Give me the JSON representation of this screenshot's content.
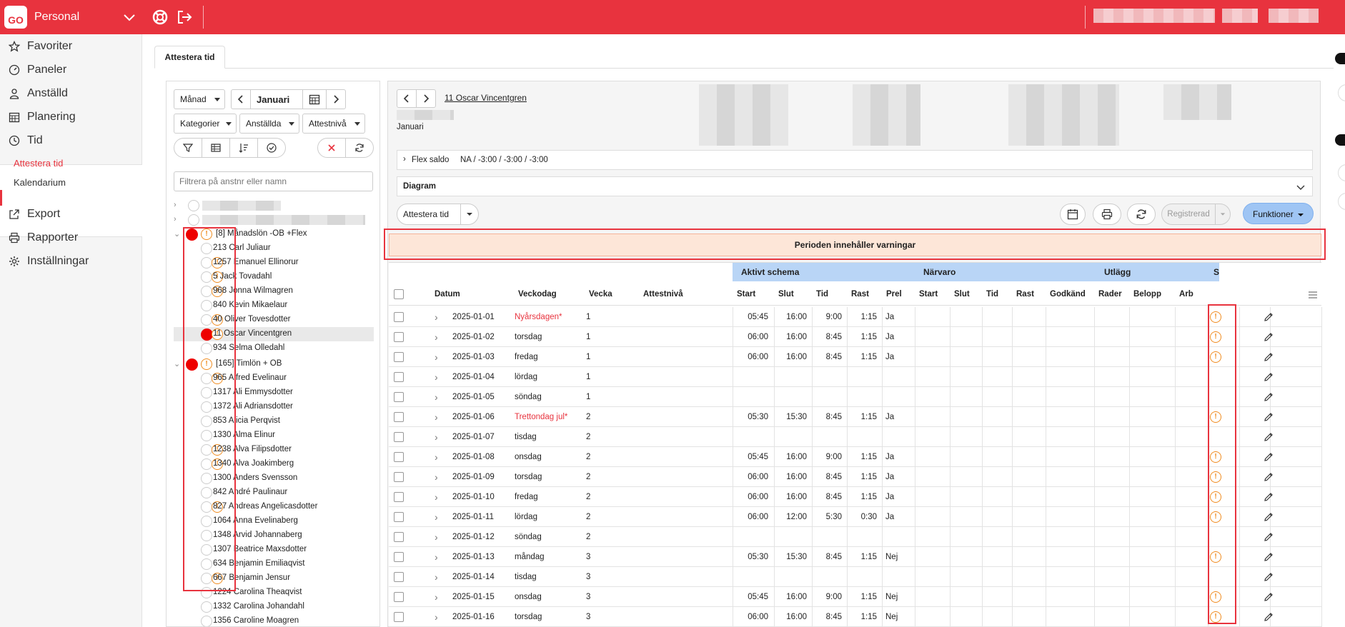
{
  "app": {
    "logo": "GO",
    "title": "Personal"
  },
  "nav": {
    "items": [
      {
        "label": "Favoriter",
        "icon": "star-icon"
      },
      {
        "label": "Paneler",
        "icon": "dashboard-icon"
      },
      {
        "label": "Anställd",
        "icon": "person-icon"
      },
      {
        "label": "Planering",
        "icon": "calendar-icon"
      },
      {
        "label": "Tid",
        "icon": "clock-icon"
      },
      {
        "label": "Export",
        "icon": "export-icon"
      },
      {
        "label": "Rapporter",
        "icon": "print-icon"
      },
      {
        "label": "Inställningar",
        "icon": "gear-icon"
      }
    ],
    "sub": [
      {
        "label": "Attestera tid",
        "active": true
      },
      {
        "label": "Kalendarium",
        "active": false
      }
    ]
  },
  "tab": {
    "label": "Attestera tid"
  },
  "filters": {
    "period": "Månad",
    "month": "Januari",
    "kategorier": "Kategorier",
    "anstallda": "Anställda",
    "attestniva": "Attestnivå",
    "search_placeholder": "Filtrera på anstnr eller namn"
  },
  "tree": {
    "groups": [
      {
        "label": "[8]  Månadslön -OB +Flex",
        "employees": [
          {
            "label": "213 Carl Juliaur",
            "warn": false
          },
          {
            "label": "1257 Emanuel Ellinorur",
            "warn": true
          },
          {
            "label": "5 Jack Tovadahl",
            "warn": true
          },
          {
            "label": "968 Jonna Wilmagren",
            "warn": true
          },
          {
            "label": "840 Kevin Mikaelaur",
            "warn": false
          },
          {
            "label": "40 Oliver Tovesdotter",
            "warn": true
          },
          {
            "label": "11 Oscar Vincentgren",
            "warn": true
          },
          {
            "label": "934 Selma Olledahl",
            "warn": false
          }
        ]
      },
      {
        "label": "[165]  Timlön + OB",
        "employees": [
          {
            "label": "965 Alfred Evelinaur",
            "warn": true
          },
          {
            "label": "1317 Ali Emmysdotter",
            "warn": false
          },
          {
            "label": "1372 Ali Adriansdotter",
            "warn": false
          },
          {
            "label": "853 Alicia Perqvist",
            "warn": false
          },
          {
            "label": "1330 Alma Elinur",
            "warn": false
          },
          {
            "label": "1238 Alva Filipsdotter",
            "warn": true
          },
          {
            "label": "1340 Alva Joakimberg",
            "warn": true
          },
          {
            "label": "1300 Anders Svensson",
            "warn": false
          },
          {
            "label": "842 André Paulinaur",
            "warn": false
          },
          {
            "label": "827 Andreas Angelicasdotter",
            "warn": true
          },
          {
            "label": "1064 Anna Evelinaberg",
            "warn": false
          },
          {
            "label": "1348 Arvid Johannaberg",
            "warn": false
          },
          {
            "label": "1307 Beatrice Maxsdotter",
            "warn": false
          },
          {
            "label": "634 Benjamin Emiliaqvist",
            "warn": false
          },
          {
            "label": "667 Benjamin Jensur",
            "warn": true
          },
          {
            "label": "1224 Carolina Theaqvist",
            "warn": false
          },
          {
            "label": "1332 Carolina Johandahl",
            "warn": false
          },
          {
            "label": "1356 Caroline Moagren",
            "warn": false
          }
        ]
      }
    ]
  },
  "employee": {
    "name": "11 Oscar Vincentgren",
    "period": "Januari",
    "flex_label": "Flex saldo",
    "flex_value": "NA / -3:00 / -3:00 / -3:00",
    "diagram": "Diagram"
  },
  "toolbar": {
    "attest_button": "Attestera tid",
    "registrerad": "Registrerad",
    "funktioner": "Funktioner"
  },
  "warning_banner": "Perioden innehåller varningar",
  "grid": {
    "groups": [
      "Aktivt schema",
      "Närvaro",
      "Utlägg",
      "St"
    ],
    "columns": [
      "Datum",
      "Veckodag",
      "Vecka",
      "Attestnivå",
      "Start",
      "Slut",
      "Tid",
      "Rast",
      "Prel",
      "Start",
      "Slut",
      "Tid",
      "Rast",
      "Godkänd",
      "Rader",
      "Belopp",
      "Arb"
    ],
    "rows": [
      {
        "date": "2025-01-01",
        "day": "Nyårsdagen*",
        "holiday": true,
        "week": "1",
        "start": "05:45",
        "end": "16:00",
        "time": "9:00",
        "rast": "1:15",
        "prel": "Ja",
        "warn": true
      },
      {
        "date": "2025-01-02",
        "day": "torsdag",
        "holiday": false,
        "week": "1",
        "start": "06:00",
        "end": "16:00",
        "time": "8:45",
        "rast": "1:15",
        "prel": "Ja",
        "warn": true
      },
      {
        "date": "2025-01-03",
        "day": "fredag",
        "holiday": false,
        "week": "1",
        "start": "06:00",
        "end": "16:00",
        "time": "8:45",
        "rast": "1:15",
        "prel": "Ja",
        "warn": true
      },
      {
        "date": "2025-01-04",
        "day": "lördag",
        "holiday": false,
        "week": "1",
        "start": "",
        "end": "",
        "time": "",
        "rast": "",
        "prel": "",
        "warn": false
      },
      {
        "date": "2025-01-05",
        "day": "söndag",
        "holiday": false,
        "week": "1",
        "start": "",
        "end": "",
        "time": "",
        "rast": "",
        "prel": "",
        "warn": false
      },
      {
        "date": "2025-01-06",
        "day": "Trettondag jul*",
        "holiday": true,
        "week": "2",
        "start": "05:30",
        "end": "15:30",
        "time": "8:45",
        "rast": "1:15",
        "prel": "Ja",
        "warn": true
      },
      {
        "date": "2025-01-07",
        "day": "tisdag",
        "holiday": false,
        "week": "2",
        "start": "",
        "end": "",
        "time": "",
        "rast": "",
        "prel": "",
        "warn": false
      },
      {
        "date": "2025-01-08",
        "day": "onsdag",
        "holiday": false,
        "week": "2",
        "start": "05:45",
        "end": "16:00",
        "time": "9:00",
        "rast": "1:15",
        "prel": "Ja",
        "warn": true
      },
      {
        "date": "2025-01-09",
        "day": "torsdag",
        "holiday": false,
        "week": "2",
        "start": "06:00",
        "end": "16:00",
        "time": "8:45",
        "rast": "1:15",
        "prel": "Ja",
        "warn": true
      },
      {
        "date": "2025-01-10",
        "day": "fredag",
        "holiday": false,
        "week": "2",
        "start": "06:00",
        "end": "16:00",
        "time": "8:45",
        "rast": "1:15",
        "prel": "Ja",
        "warn": true
      },
      {
        "date": "2025-01-11",
        "day": "lördag",
        "holiday": false,
        "week": "2",
        "start": "06:00",
        "end": "12:00",
        "time": "5:30",
        "rast": "0:30",
        "prel": "Ja",
        "warn": true
      },
      {
        "date": "2025-01-12",
        "day": "söndag",
        "holiday": false,
        "week": "2",
        "start": "",
        "end": "",
        "time": "",
        "rast": "",
        "prel": "",
        "warn": false
      },
      {
        "date": "2025-01-13",
        "day": "måndag",
        "holiday": false,
        "week": "3",
        "start": "05:30",
        "end": "15:30",
        "time": "8:45",
        "rast": "1:15",
        "prel": "Nej",
        "warn": true
      },
      {
        "date": "2025-01-14",
        "day": "tisdag",
        "holiday": false,
        "week": "3",
        "start": "",
        "end": "",
        "time": "",
        "rast": "",
        "prel": "",
        "warn": false
      },
      {
        "date": "2025-01-15",
        "day": "onsdag",
        "holiday": false,
        "week": "3",
        "start": "05:45",
        "end": "16:00",
        "time": "9:00",
        "rast": "1:15",
        "prel": "Nej",
        "warn": true
      },
      {
        "date": "2025-01-16",
        "day": "torsdag",
        "holiday": false,
        "week": "3",
        "start": "06:00",
        "end": "16:00",
        "time": "8:45",
        "rast": "1:15",
        "prel": "Nej",
        "warn": true
      }
    ]
  },
  "colors": {
    "brand": "#e8333e",
    "warning": "#f08c20",
    "group_header": "#b9d5f6",
    "banner": "#fde6d8"
  }
}
